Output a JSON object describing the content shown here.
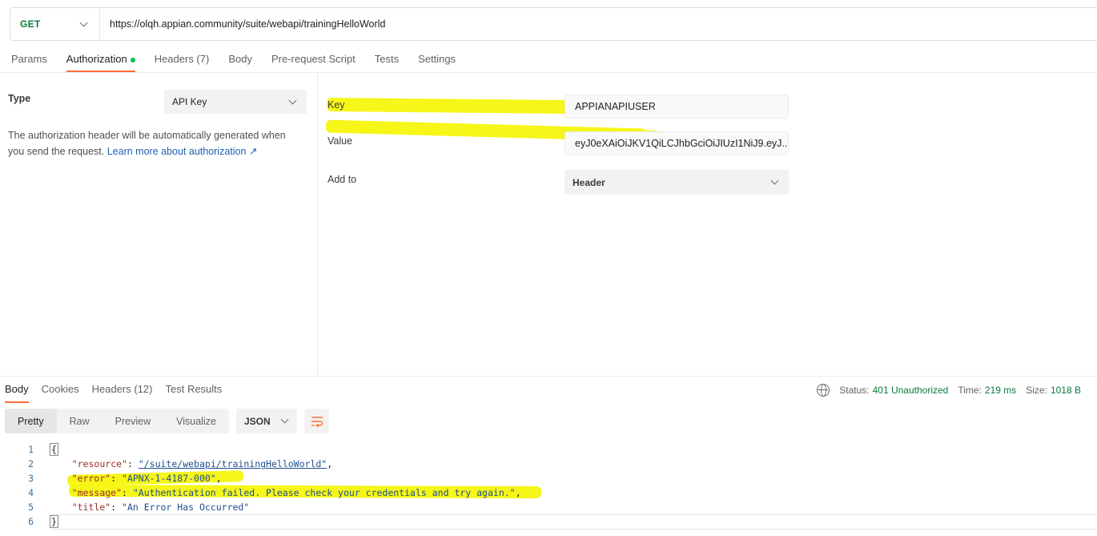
{
  "request": {
    "method": "GET",
    "url": "https://olqh.appian.community/suite/webapi/trainingHelloWorld"
  },
  "request_tabs": [
    "Params",
    "Authorization",
    "Headers (7)",
    "Body",
    "Pre-request Script",
    "Tests",
    "Settings"
  ],
  "auth": {
    "type_label": "Type",
    "type_value": "API Key",
    "description": "The authorization header will be automatically generated when you send the request.",
    "link_text": "Learn more about authorization ↗",
    "key_label": "Key",
    "key_value": "APPIANAPIUSER",
    "value_label": "Value",
    "value_value": "eyJ0eXAiOiJKV1QiLCJhbGciOiJIUzI1NiJ9.eyJ...",
    "addto_label": "Add to",
    "addto_value": "Header"
  },
  "response_tabs": [
    "Body",
    "Cookies",
    "Headers (12)",
    "Test Results"
  ],
  "status": {
    "status_label": "Status:",
    "status_value": "401 Unauthorized",
    "time_label": "Time:",
    "time_value": "219 ms",
    "size_label": "Size:",
    "size_value": "1018 B"
  },
  "format_tabs": [
    "Pretty",
    "Raw",
    "Preview",
    "Visualize"
  ],
  "format_select": "JSON",
  "code": {
    "line_numbers": [
      "1",
      "2",
      "3",
      "4",
      "5",
      "6"
    ],
    "open_brace": "{",
    "close_brace": "}",
    "resource_key": "\"resource\"",
    "resource_value": "\"/suite/webapi/trainingHelloWorld\"",
    "error_key": "\"error\"",
    "error_value": "\"APNX-1-4187-000\"",
    "message_key": "\"message\"",
    "message_value": "\"Authentication failed. Please check your credentials and try again.\"",
    "title_key": "\"title\"",
    "title_value": "\"An Error Has Occurred\""
  },
  "colors": {
    "accent": "#ff6c37",
    "method_green": "#0b7a3b",
    "highlight": "#f5f500"
  }
}
